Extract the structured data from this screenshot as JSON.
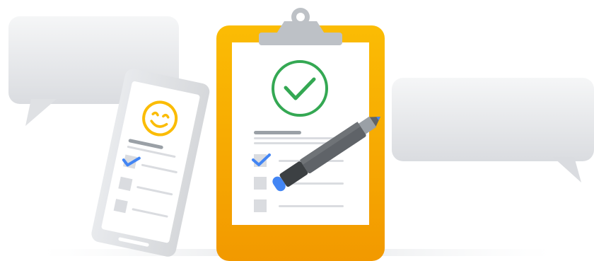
{
  "colors": {
    "bubble_light": "#f5f6f7",
    "bubble_dark": "#dadce0",
    "clipboard_top": "#fbbc04",
    "clipboard_bottom": "#f29900",
    "clip_metal": "#bdc1c6",
    "check_green": "#34a853",
    "check_blue": "#4285f4",
    "smiley_yellow": "#fbbc04",
    "text_line": "#dadce0",
    "heading_line": "#9aa0a6",
    "pen_body": "#5f6368",
    "pen_dark": "#3c4043",
    "pen_tip": "#4285f4",
    "phone_body": "#e8eaed"
  },
  "icons": {
    "clipboard_mark": "check-circle-icon",
    "phone_mark": "smiley-face-icon",
    "checklist_checked": "checkmark-icon",
    "checklist_empty": "empty-checkbox-icon",
    "tool": "pen-icon"
  },
  "clipboard_checklist": {
    "items": [
      {
        "checked": true
      },
      {
        "checked": false
      },
      {
        "checked": false
      }
    ]
  },
  "phone_checklist": {
    "items": [
      {
        "checked": true
      },
      {
        "checked": false
      },
      {
        "checked": false
      }
    ]
  }
}
